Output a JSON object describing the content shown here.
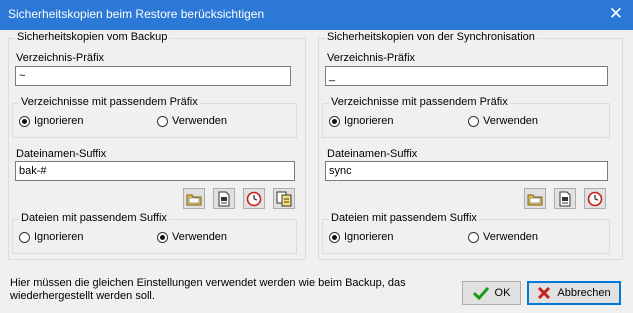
{
  "window": {
    "title": "Sicherheitskopien beim Restore berücksichtigen",
    "close_symbol": "✕"
  },
  "backup": {
    "group_title": "Sicherheitskopien vom Backup",
    "dir_prefix_label": "Verzeichnis-Präfix",
    "dir_prefix_value": "~",
    "dir_group_title": "Verzeichnisse mit passendem Präfix",
    "dir_ignore": "Ignorieren",
    "dir_use": "Verwenden",
    "file_suffix_label": "Dateinamen-Suffix",
    "file_suffix_value": "bak-#",
    "file_group_title": "Dateien mit passendem Suffix",
    "file_ignore": "Ignorieren",
    "file_use": "Verwenden"
  },
  "sync": {
    "group_title": "Sicherheitskopien von der Synchronisation",
    "dir_prefix_label": "Verzeichnis-Präfix",
    "dir_prefix_value": "_",
    "dir_group_title": "Verzeichnisse mit passendem Präfix",
    "dir_ignore": "Ignorieren",
    "dir_use": "Verwenden",
    "file_suffix_label": "Dateinamen-Suffix",
    "file_suffix_value": "sync",
    "file_group_title": "Dateien mit passendem Suffix",
    "file_ignore": "Ignorieren",
    "file_use": "Verwenden"
  },
  "hint": "Hier müssen die gleichen Einstellungen verwendet werden wie beim Backup, das wiederhergestellt werden soll.",
  "buttons": {
    "ok": "OK",
    "cancel": "Abbrechen"
  },
  "colors": {
    "titlebar": "#2b78d6",
    "ok_check": "#1a9a1a",
    "cancel_x": "#c81e1e"
  }
}
